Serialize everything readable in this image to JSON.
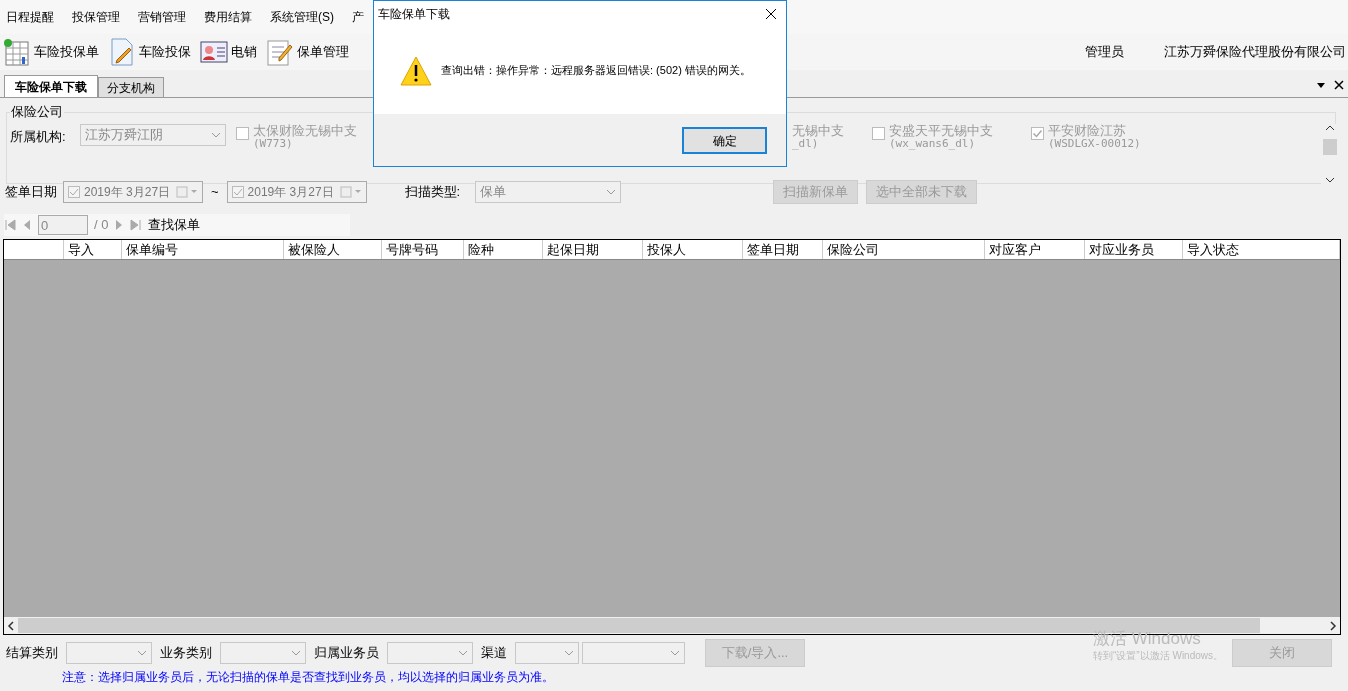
{
  "menu": [
    "日程提醒",
    "投保管理",
    "营销管理",
    "费用结算",
    "系统管理(S)",
    "产"
  ],
  "toolbar": [
    {
      "kind": "table",
      "label": "车险投保单"
    },
    {
      "kind": "doc",
      "label": "车险投保"
    },
    {
      "kind": "card",
      "label": "电销"
    },
    {
      "kind": "list",
      "label": "保单管理"
    }
  ],
  "user": "管理员",
  "company": "江苏万舜保险代理股份有限公司",
  "tabs": [
    {
      "label": "车险保单下载",
      "selected": true
    },
    {
      "label": "分支机构",
      "selected": false
    }
  ],
  "filter": {
    "group_title": "保险公司",
    "org_label": "所属机构:",
    "org_value": "江苏万舜江阴",
    "companies": [
      {
        "kind": "full",
        "label": "太保财险无锡中支",
        "code": "(W773)",
        "checked": false
      },
      {
        "kind": "partial",
        "label": "无锡中支",
        "code": "_dl)"
      },
      {
        "kind": "full",
        "label": "安盛天平无锡中支",
        "code": "(wx_wans6_dl)",
        "checked": false
      },
      {
        "kind": "full",
        "label": "平安财险江苏",
        "code": "(WSDLGX-00012)",
        "checked": true
      }
    ],
    "date_label": "签单日期",
    "date_from": "2019年  3月27日",
    "date_sep": "~",
    "date_to": "2019年  3月27日",
    "scan_label": "扫描类型:",
    "scan_value": "保单",
    "buttons": [
      "扫描新保单",
      "选中全部未下载"
    ]
  },
  "nav": {
    "page": "0",
    "total": "/ 0",
    "find": "查找保单"
  },
  "table": {
    "columns": [
      "导入",
      "保单编号",
      "被保险人",
      "号牌号码",
      "险种",
      "起保日期",
      "投保人",
      "签单日期",
      "保险公司",
      "对应客户",
      "对应业务员",
      "导入状态"
    ]
  },
  "bottom": {
    "fields": [
      "结算类别",
      "业务类别",
      "归属业务员",
      "渠道"
    ],
    "action": "下载/导入...",
    "close": "关闭",
    "note": "注意：选择归属业务员后，无论扫描的保单是否查找到业务员，均以选择的归属业务员为准。"
  },
  "activation": {
    "title": "激活 Windows",
    "text": "转到“设置”以激活 Windows。"
  },
  "dialog": {
    "title": "车险保单下载",
    "message": "查询出错：操作异常：远程服务器返回错误: (502) 错误的网关。",
    "ok": "确定"
  }
}
